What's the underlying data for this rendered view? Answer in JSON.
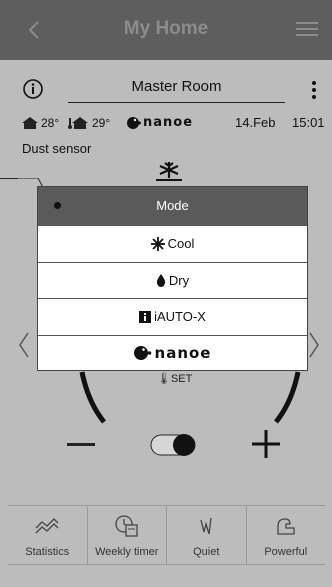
{
  "header": {
    "title": "My Home"
  },
  "room": {
    "name": "Master Room"
  },
  "status": {
    "indoor_temp": "28°",
    "outdoor_temp": "29°",
    "nanoe_label": "nanoe",
    "date": "14.Feb",
    "time": "15:01"
  },
  "dust_sensor_label": "Dust sensor",
  "mode_panel": {
    "title": "Mode",
    "items": [
      {
        "label": "Cool",
        "icon": "snowflake-icon"
      },
      {
        "label": "Dry",
        "icon": "droplet-icon"
      },
      {
        "label": "iAUTO-X",
        "icon": "info-box-icon"
      },
      {
        "label": "nanoe",
        "icon": "nanoe-icon"
      }
    ]
  },
  "set_label": "SET",
  "tabs": [
    {
      "label": "Statistics",
      "icon": "statistics-icon"
    },
    {
      "label": "Weekly timer",
      "icon": "weekly-timer-icon"
    },
    {
      "label": "Quiet",
      "icon": "quiet-icon"
    },
    {
      "label": "Powerful",
      "icon": "powerful-icon"
    }
  ],
  "colors": {
    "header_bg": "#5e5e5e",
    "overlay_bg": "#bcbcbc",
    "panel_header_bg": "#5a5a5a"
  }
}
